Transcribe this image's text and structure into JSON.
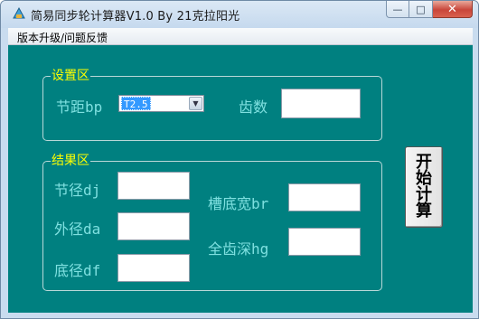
{
  "window": {
    "title": "简易同步轮计算器V1.0  By 21克拉阳光",
    "minimize_glyph": "—",
    "maximize_glyph": "□",
    "close_glyph": "✕"
  },
  "menu": {
    "items": [
      {
        "label": "版本升级/问题反馈"
      }
    ]
  },
  "settings_group": {
    "title": "设置区",
    "pitch_label": "节距bp",
    "pitch_value": "T2.5",
    "teeth_label": "齿数",
    "teeth_value": ""
  },
  "results_group": {
    "title": "结果区",
    "pitch_diameter_label": "节径dj",
    "pitch_diameter_value": "",
    "outer_diameter_label": "外径da",
    "outer_diameter_value": "",
    "root_diameter_label": "底径df",
    "root_diameter_value": "",
    "groove_width_label": "槽底宽br",
    "groove_width_value": "",
    "tooth_depth_label": "全齿深hg",
    "tooth_depth_value": ""
  },
  "start_button": {
    "label": "开始计算"
  },
  "colors": {
    "client_background": "#008080",
    "group_title": "#ffff00",
    "label_text": "#7fe0e0"
  }
}
